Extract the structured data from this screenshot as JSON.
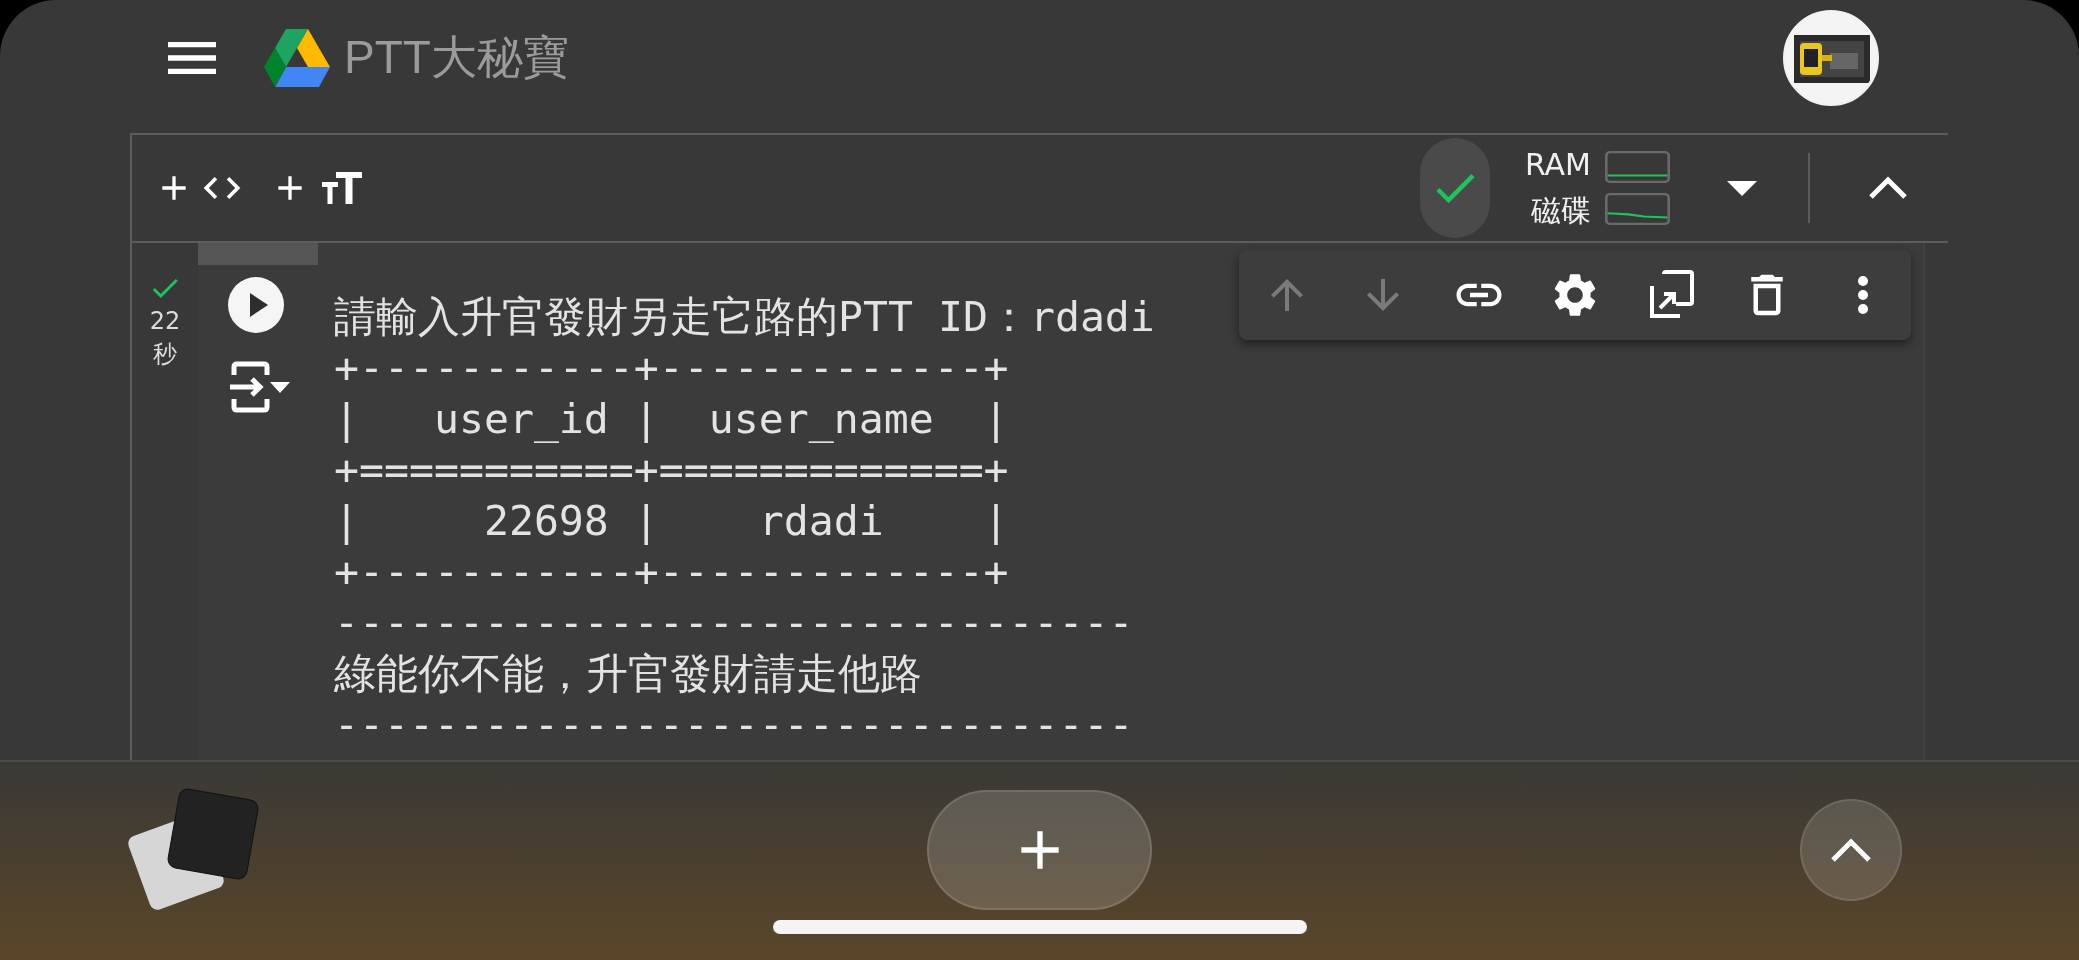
{
  "header": {
    "title": "PTT大秘寶"
  },
  "toolbar": {
    "runtime": {
      "connected": true
    },
    "resources": [
      {
        "label": "RAM"
      },
      {
        "label": "磁碟"
      }
    ]
  },
  "cell": {
    "succeeded": true,
    "duration": "22",
    "duration_unit": "秒",
    "output_lines": [
      "請輸入升官發財另走它路的PTT ID：rdadi",
      "+-----------+-------------+",
      "|   user_id |  user_name  |",
      "+===========+=============+",
      "|     22698 |    rdadi    |",
      "+-----------+-------------+",
      "--------------------------------",
      "綠能你不能，升官發財請走他路",
      "--------------------------------"
    ],
    "actions": [
      {
        "kind": "up",
        "disabled": true
      },
      {
        "kind": "down",
        "disabled": true
      },
      {
        "kind": "link",
        "disabled": false
      },
      {
        "kind": "settings",
        "disabled": false
      },
      {
        "kind": "mirror",
        "disabled": false
      },
      {
        "kind": "delete",
        "disabled": false
      },
      {
        "kind": "more",
        "disabled": false
      }
    ]
  }
}
